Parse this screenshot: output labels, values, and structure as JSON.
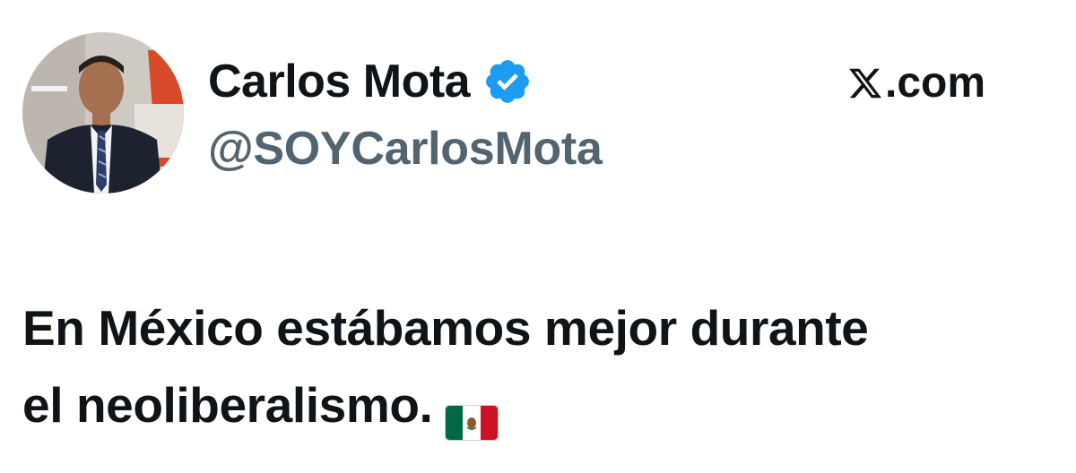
{
  "author": {
    "display_name": "Carlos Mota",
    "handle": "@SOYCarlosMota",
    "verified": true,
    "verified_icon": "verified-badge-icon",
    "verified_color": "#1d9bf0",
    "avatar_icon": "profile-photo"
  },
  "brand": {
    "logo_icon": "x-logo-icon",
    "text": ".com"
  },
  "tweet": {
    "line1": "En México estábamos mejor durante",
    "line2": "el neoliberalismo.",
    "emoji_icon": "mexico-flag-icon"
  },
  "colors": {
    "text_primary": "#0f1419",
    "text_secondary": "#536471",
    "background": "#ffffff"
  }
}
